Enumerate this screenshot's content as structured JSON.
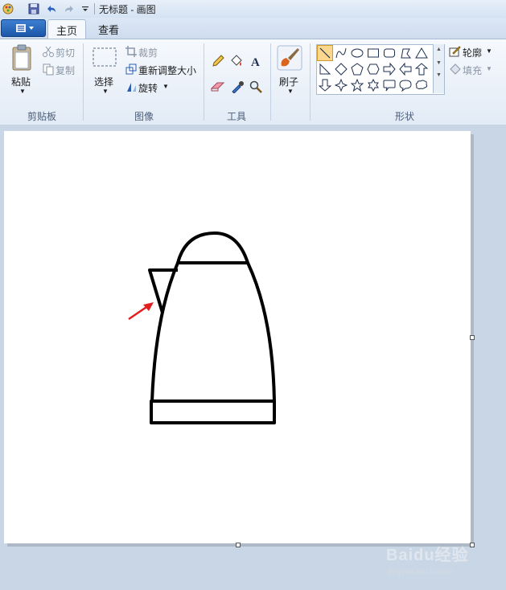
{
  "window": {
    "title": "无标题 - 画图"
  },
  "tabs": [
    {
      "label": "主页",
      "active": true
    },
    {
      "label": "查看",
      "active": false
    }
  ],
  "clipboard": {
    "paste_label": "粘贴",
    "cut_label": "剪切",
    "copy_label": "复制",
    "group_label": "剪贴板"
  },
  "image": {
    "select_label": "选择",
    "crop_label": "裁剪",
    "resize_label": "重新调整大小",
    "rotate_label": "旋转",
    "group_label": "图像"
  },
  "tools": {
    "group_label": "工具",
    "items": [
      "pencil-icon",
      "fill-icon",
      "text-icon",
      "eraser-icon",
      "color-picker-icon",
      "magnifier-icon"
    ]
  },
  "brushes": {
    "label": "刷子"
  },
  "shapes": {
    "group_label": "形状",
    "outline_label": "轮廓",
    "fill_label": "填充",
    "items": [
      "line",
      "curve",
      "oval",
      "rectangle",
      "rounded-rectangle",
      "polygon",
      "triangle",
      "right-triangle",
      "diamond",
      "pentagon",
      "hexagon",
      "right-arrow",
      "left-arrow",
      "up-arrow",
      "down-arrow",
      "four-point-star",
      "five-point-star",
      "six-point-star",
      "rounded-callout",
      "oval-callout",
      "cloud-callout"
    ]
  },
  "colors": {
    "accent": "#1c56a8",
    "arrow": "#e02020",
    "selected_shape_bg": "#fbd88e"
  },
  "watermark": {
    "brand": "Baidu经验",
    "url": "jingyan.baidu.com"
  }
}
